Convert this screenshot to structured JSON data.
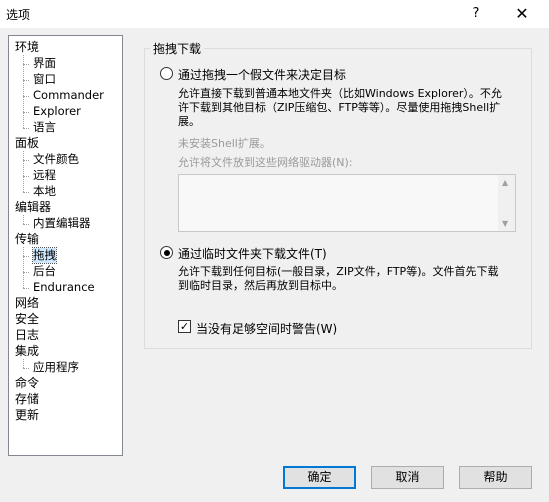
{
  "window": {
    "title": "选项",
    "help": "?",
    "close": "✕"
  },
  "tree": {
    "items": [
      {
        "label": "环境",
        "level": 0
      },
      {
        "label": "界面",
        "level": 1
      },
      {
        "label": "窗口",
        "level": 1
      },
      {
        "label": "Commander",
        "level": 1
      },
      {
        "label": "Explorer",
        "level": 1
      },
      {
        "label": "语言",
        "level": 1
      },
      {
        "label": "面板",
        "level": 0
      },
      {
        "label": "文件颜色",
        "level": 1
      },
      {
        "label": "远程",
        "level": 1
      },
      {
        "label": "本地",
        "level": 1
      },
      {
        "label": "编辑器",
        "level": 0
      },
      {
        "label": "内置编辑器",
        "level": 1
      },
      {
        "label": "传输",
        "level": 0
      },
      {
        "label": "拖拽",
        "level": 1,
        "selected": true
      },
      {
        "label": "后台",
        "level": 1
      },
      {
        "label": "Endurance",
        "level": 1
      },
      {
        "label": "网络",
        "level": 0
      },
      {
        "label": "安全",
        "level": 0
      },
      {
        "label": "日志",
        "level": 0
      },
      {
        "label": "集成",
        "level": 0
      },
      {
        "label": "应用程序",
        "level": 1
      },
      {
        "label": "命令",
        "level": 0
      },
      {
        "label": "存储",
        "level": 0
      },
      {
        "label": "更新",
        "level": 0
      }
    ]
  },
  "panel": {
    "group_title": "拖拽下载",
    "option1": {
      "label": "通过拖拽一个假文件来决定目标",
      "desc_line1": "允许直接下载到普通本地文件夹（比如Windows Explorer）。不允",
      "desc_line2": "许下载到其他目标（ZIP压缩包、FTP等等）。尽量使用拖拽Shell扩",
      "desc_line3": "展。",
      "shell_status": "未安装Shell扩展。",
      "network_label": "允许将文件放到这些网络驱动器(N):"
    },
    "option2": {
      "label": "通过临时文件夹下载文件(T)",
      "desc_line1": "允许下载到任何目标(一般目录，ZIP文件，FTP等)。文件首先下载",
      "desc_line2": "到临时目录，然后再放到目标中。"
    },
    "warn_checkbox": "当没有足够空间时警告(W)",
    "check_mark": "✓"
  },
  "buttons": {
    "ok": "确定",
    "cancel": "取消",
    "help": "帮助"
  }
}
